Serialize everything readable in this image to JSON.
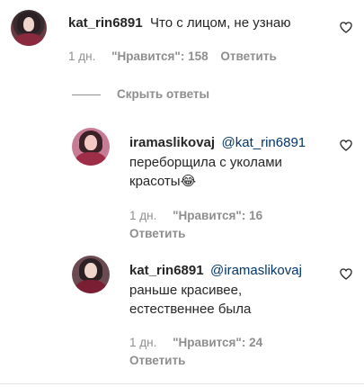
{
  "comments": [
    {
      "username": "kat_rin6891",
      "mention": "",
      "text": "Что с лицом, не узнаю",
      "time": "1 дн.",
      "likes": "\"Нравится\": 158",
      "reply": "Ответить"
    }
  ],
  "hide_replies_label": "Скрыть ответы",
  "replies": [
    {
      "username": "iramaslikovaj",
      "mention": "@kat_rin6891",
      "text_line1": "переборщила с уколами",
      "text_line2": "красоты😂",
      "time": "1 дн.",
      "likes": "\"Нравится\": 16",
      "reply": "Ответить"
    },
    {
      "username": "kat_rin6891",
      "mention": "@iramaslikovaj",
      "text_line1": "раньше красивее,",
      "text_line2": "естественнее была",
      "time": "1 дн.",
      "likes": "\"Нравится\": 24",
      "reply": "Ответить"
    }
  ],
  "icons": {
    "like": "heart-icon"
  }
}
